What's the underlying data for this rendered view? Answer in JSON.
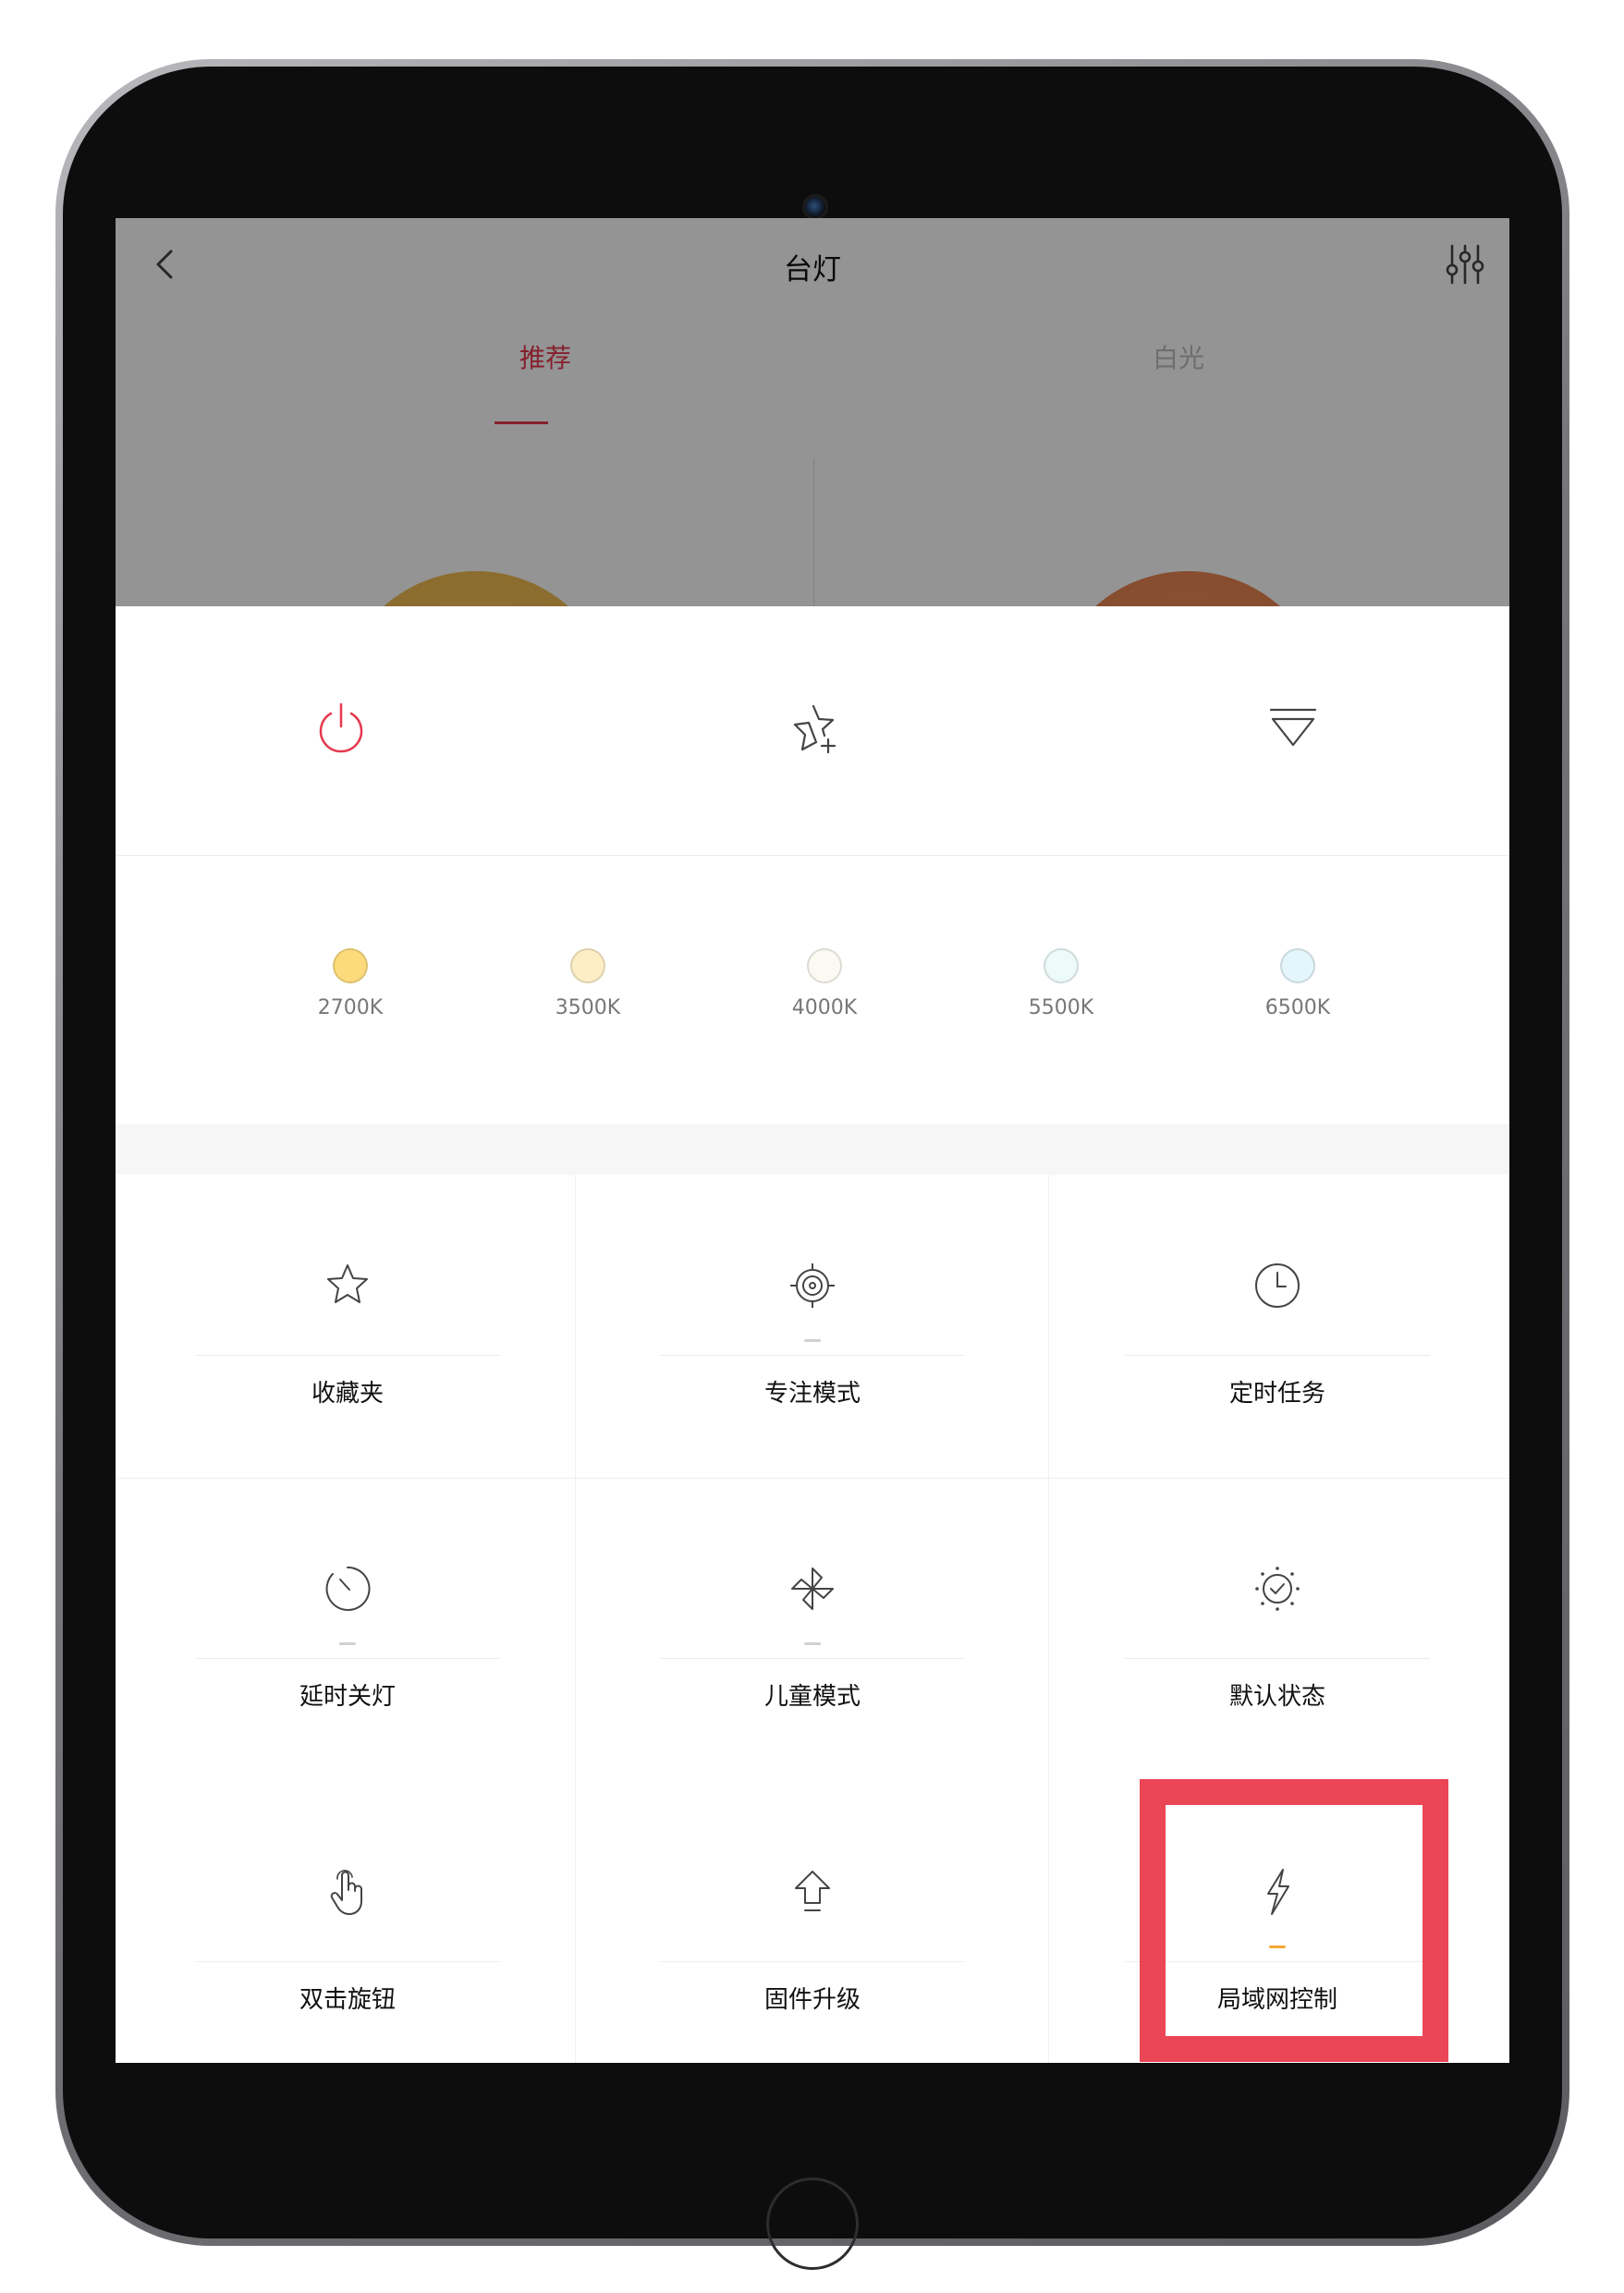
{
  "nav": {
    "title": "台灯"
  },
  "tabs": [
    {
      "label": "推荐"
    },
    {
      "label": "白光"
    }
  ],
  "actions": [
    {
      "icon": "power-icon",
      "color": "#e6394f"
    },
    {
      "icon": "star-plus-icon"
    },
    {
      "icon": "dropdown-triangle-icon"
    }
  ],
  "temperatures": [
    {
      "label": "2700K",
      "color": "#fddb7d"
    },
    {
      "label": "3500K",
      "color": "#fdeec6"
    },
    {
      "label": "4000K",
      "color": "#fbfaf2"
    },
    {
      "label": "5500K",
      "color": "#ecfaf9"
    },
    {
      "label": "6500K",
      "color": "#e4f6fb"
    }
  ],
  "features": [
    {
      "label": "收藏夹",
      "icon": "star-icon"
    },
    {
      "label": "专注模式",
      "icon": "target-icon"
    },
    {
      "label": "定时任务",
      "icon": "clock-icon"
    },
    {
      "label": "延时关灯",
      "icon": "timer-icon"
    },
    {
      "label": "儿童模式",
      "icon": "pinwheel-icon"
    },
    {
      "label": "默认状态",
      "icon": "sun-check-icon"
    },
    {
      "label": "双击旋钮",
      "icon": "tap-hand-icon"
    },
    {
      "label": "固件升级",
      "icon": "upload-arrow-icon"
    },
    {
      "label": "局域网控制",
      "icon": "lightning-icon"
    }
  ],
  "colors": {
    "accent": "#e6394f",
    "highlight": "#ea4656",
    "active_dash": "#f3a935"
  }
}
